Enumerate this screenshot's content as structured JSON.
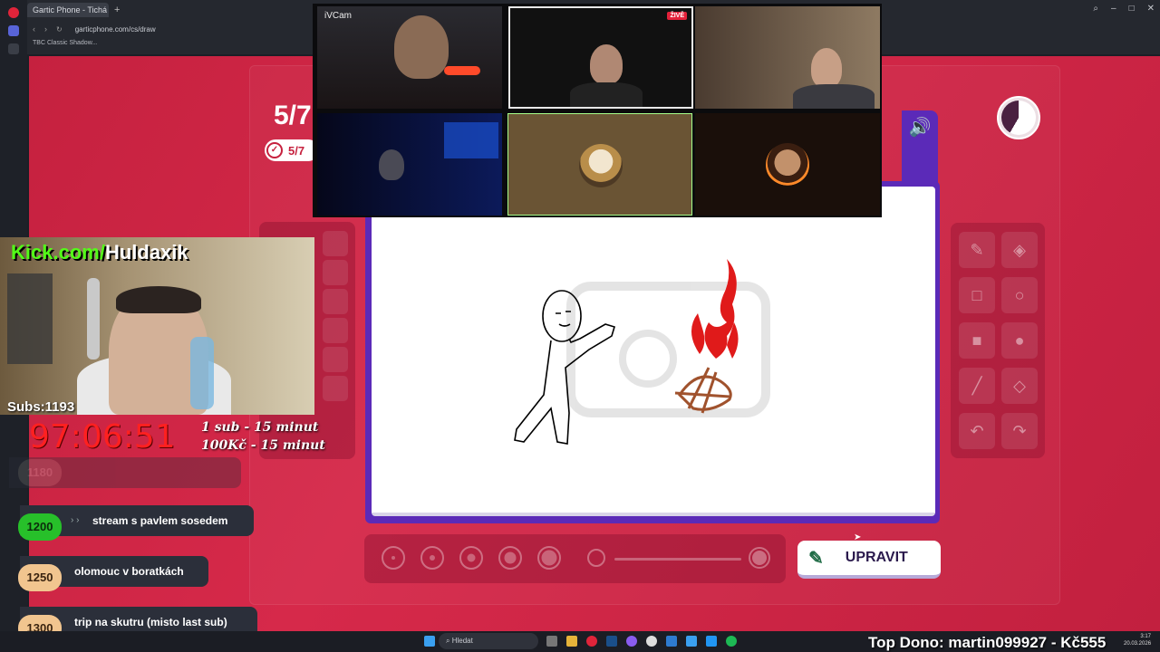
{
  "browser": {
    "tab_title": "Gartic Phone - Tichá poš...",
    "new_tab": "+",
    "url": "garticphone.com/cs/draw",
    "bookmark": "TBC Classic Shadow..."
  },
  "game": {
    "round": "5/7",
    "round_sub": "5/7",
    "button_label": "UPRAVIT",
    "sound_icon": "speaker-icon",
    "timer_remaining_fraction": 0.42
  },
  "video_call": {
    "first_tile_label": "iVCam",
    "live_badge": "ŽIVĚ"
  },
  "stream_overlay": {
    "kick_prefix": "Kick.com/",
    "kick_name": "Huldaxik",
    "subs": "Subs:1193",
    "timer": "97:06:51",
    "rate_sub": "1 sub - 15 minut",
    "rate_kc": "100Kč - 15 minut",
    "goals": [
      {
        "num": "1180",
        "text": ""
      },
      {
        "num": "1200",
        "text": "stream s pavlem sosedem"
      },
      {
        "num": "1250",
        "text": "olomouc v boratkách"
      },
      {
        "num": "1300",
        "text": "trip na skutru (misto last sub)"
      }
    ],
    "top_dono": "Top Dono: martin099927 - Kč555"
  },
  "taskbar": {
    "search_label": "Hledat",
    "time": "3:17",
    "date": "20.03.2026"
  },
  "colors": {
    "game_bg": "#d6294a",
    "accent_purple": "#5b2ab8",
    "kick_green": "#53fc18",
    "timer_red": "#ff2020"
  }
}
